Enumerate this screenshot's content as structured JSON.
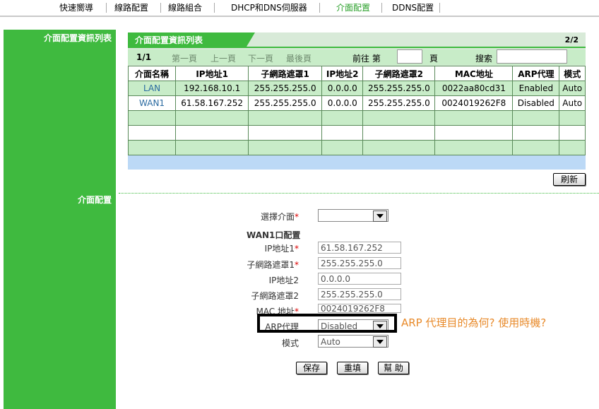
{
  "nav": {
    "tabs": [
      {
        "label": "快速嚮導"
      },
      {
        "label": "線路配置"
      },
      {
        "label": "線路組合"
      },
      {
        "label": "DHCP和DNS伺服器"
      },
      {
        "label": "介面配置"
      },
      {
        "label": "DDNS配置"
      }
    ],
    "active_tab": "介面配置"
  },
  "sidebar": {
    "list_label": "介面配置資訊列表",
    "config_label": "介面配置"
  },
  "list_panel": {
    "title": "介面配置資訊列表",
    "page_count": "2/2",
    "pager": {
      "current": "1/1",
      "first": "第一頁",
      "prev": "上一頁",
      "next": "下一頁",
      "last": "最後頁",
      "goto_prefix": "前往 第",
      "goto_suffix": "頁",
      "goto_value": "",
      "search_label": "搜索",
      "search_value": ""
    },
    "columns": [
      "介面名稱",
      "IP地址1",
      "子網路遮罩1",
      "IP地址2",
      "子網路遮罩2",
      "MAC地址",
      "ARP代理",
      "模式"
    ],
    "rows": [
      [
        "LAN",
        "192.168.10.1",
        "255.255.255.0",
        "0.0.0.0",
        "255.255.255.0",
        "0022aa80cd31",
        "Enabled",
        "Auto"
      ],
      [
        "WAN1",
        "61.58.167.252",
        "255.255.255.0",
        "0.0.0.0",
        "255.255.255.0",
        "0024019262F8",
        "Disabled",
        "Auto"
      ],
      [
        "",
        "",
        "",
        "",
        "",
        "",
        "",
        ""
      ],
      [
        "",
        "",
        "",
        "",
        "",
        "",
        "",
        ""
      ],
      [
        "",
        "",
        "",
        "",
        "",
        "",
        "",
        ""
      ]
    ],
    "refresh_label": "刷新"
  },
  "config_form": {
    "select_interface_label": "選擇介面",
    "select_interface_value": "",
    "section_title": "WAN1口配置",
    "ip1_label": "IP地址1",
    "ip1_value": "61.58.167.252",
    "mask1_label": "子網路遮罩1",
    "mask1_value": "255.255.255.0",
    "ip2_label": "IP地址2",
    "ip2_value": "0.0.0.0",
    "mask2_label": "子網路遮罩2",
    "mask2_value": "255.255.255.0",
    "mac_label": "MAC 地址",
    "mac_value": "0024019262F8",
    "arp_label": "ARP代理",
    "arp_value": "Disabled",
    "mode_label": "模式",
    "mode_value": "Auto",
    "required_mark": "*",
    "save_label": "保存",
    "reset_label": "重填",
    "help_label": "幫 助"
  },
  "annotation": {
    "text": "ARP 代理目的為何? 使用時機?",
    "color": "#e88a2a"
  },
  "colors": {
    "brand_green": "#3fba3f",
    "row_green": "#c8ecc8",
    "blue_bar": "#bcd9f6"
  }
}
